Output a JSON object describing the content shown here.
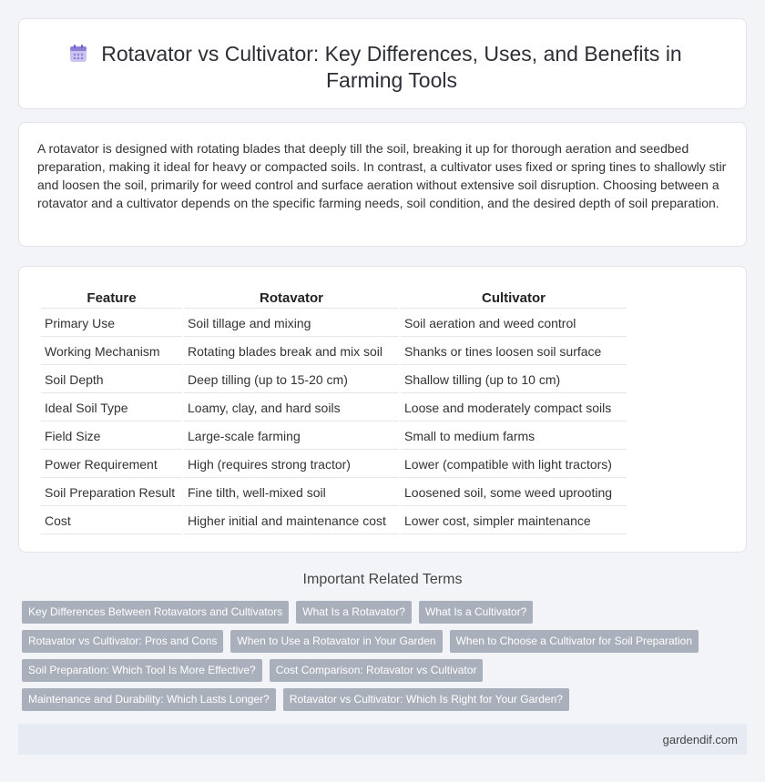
{
  "header": {
    "title": "Rotavator vs Cultivator: Key Differences, Uses, and Benefits in Farming Tools",
    "icon": "calendar-icon"
  },
  "intro": {
    "text": "A rotavator is designed with rotating blades that deeply till the soil, breaking it up for thorough aeration and seedbed preparation, making it ideal for heavy or compacted soils. In contrast, a cultivator uses fixed or spring tines to shallowly stir and loosen the soil, primarily for weed control and surface aeration without extensive soil disruption. Choosing between a rotavator and a cultivator depends on the specific farming needs, soil condition, and the desired depth of soil preparation."
  },
  "table": {
    "headers": [
      "Feature",
      "Rotavator",
      "Cultivator"
    ],
    "rows": [
      [
        "Primary Use",
        "Soil tillage and mixing",
        "Soil aeration and weed control"
      ],
      [
        "Working Mechanism",
        "Rotating blades break and mix soil",
        "Shanks or tines loosen soil surface"
      ],
      [
        "Soil Depth",
        "Deep tilling (up to 15-20 cm)",
        "Shallow tilling (up to 10 cm)"
      ],
      [
        "Ideal Soil Type",
        "Loamy, clay, and hard soils",
        "Loose and moderately compact soils"
      ],
      [
        "Field Size",
        "Large-scale farming",
        "Small to medium farms"
      ],
      [
        "Power Requirement",
        "High (requires strong tractor)",
        "Lower (compatible with light tractors)"
      ],
      [
        "Soil Preparation Result",
        "Fine tilth, well-mixed soil",
        "Loosened soil, some weed uprooting"
      ],
      [
        "Cost",
        "Higher initial and maintenance cost",
        "Lower cost, simpler maintenance"
      ]
    ]
  },
  "related": {
    "title": "Important Related Terms",
    "tags": [
      "Key Differences Between Rotavators and Cultivators",
      "What Is a Rotavator?",
      "What Is a Cultivator?",
      "Rotavator vs Cultivator: Pros and Cons",
      "When to Use a Rotavator in Your Garden",
      "When to Choose a Cultivator for Soil Preparation",
      "Soil Preparation: Which Tool Is More Effective?",
      "Cost Comparison: Rotavator vs Cultivator",
      "Maintenance and Durability: Which Lasts Longer?",
      "Rotavator vs Cultivator: Which Is Right for Your Garden?"
    ]
  },
  "footer": {
    "site": "gardendif.com"
  },
  "colors": {
    "tag_bg": "#aab0bb",
    "footer_bg": "#e6eaf3",
    "icon_accent": "#8b7fd6"
  }
}
